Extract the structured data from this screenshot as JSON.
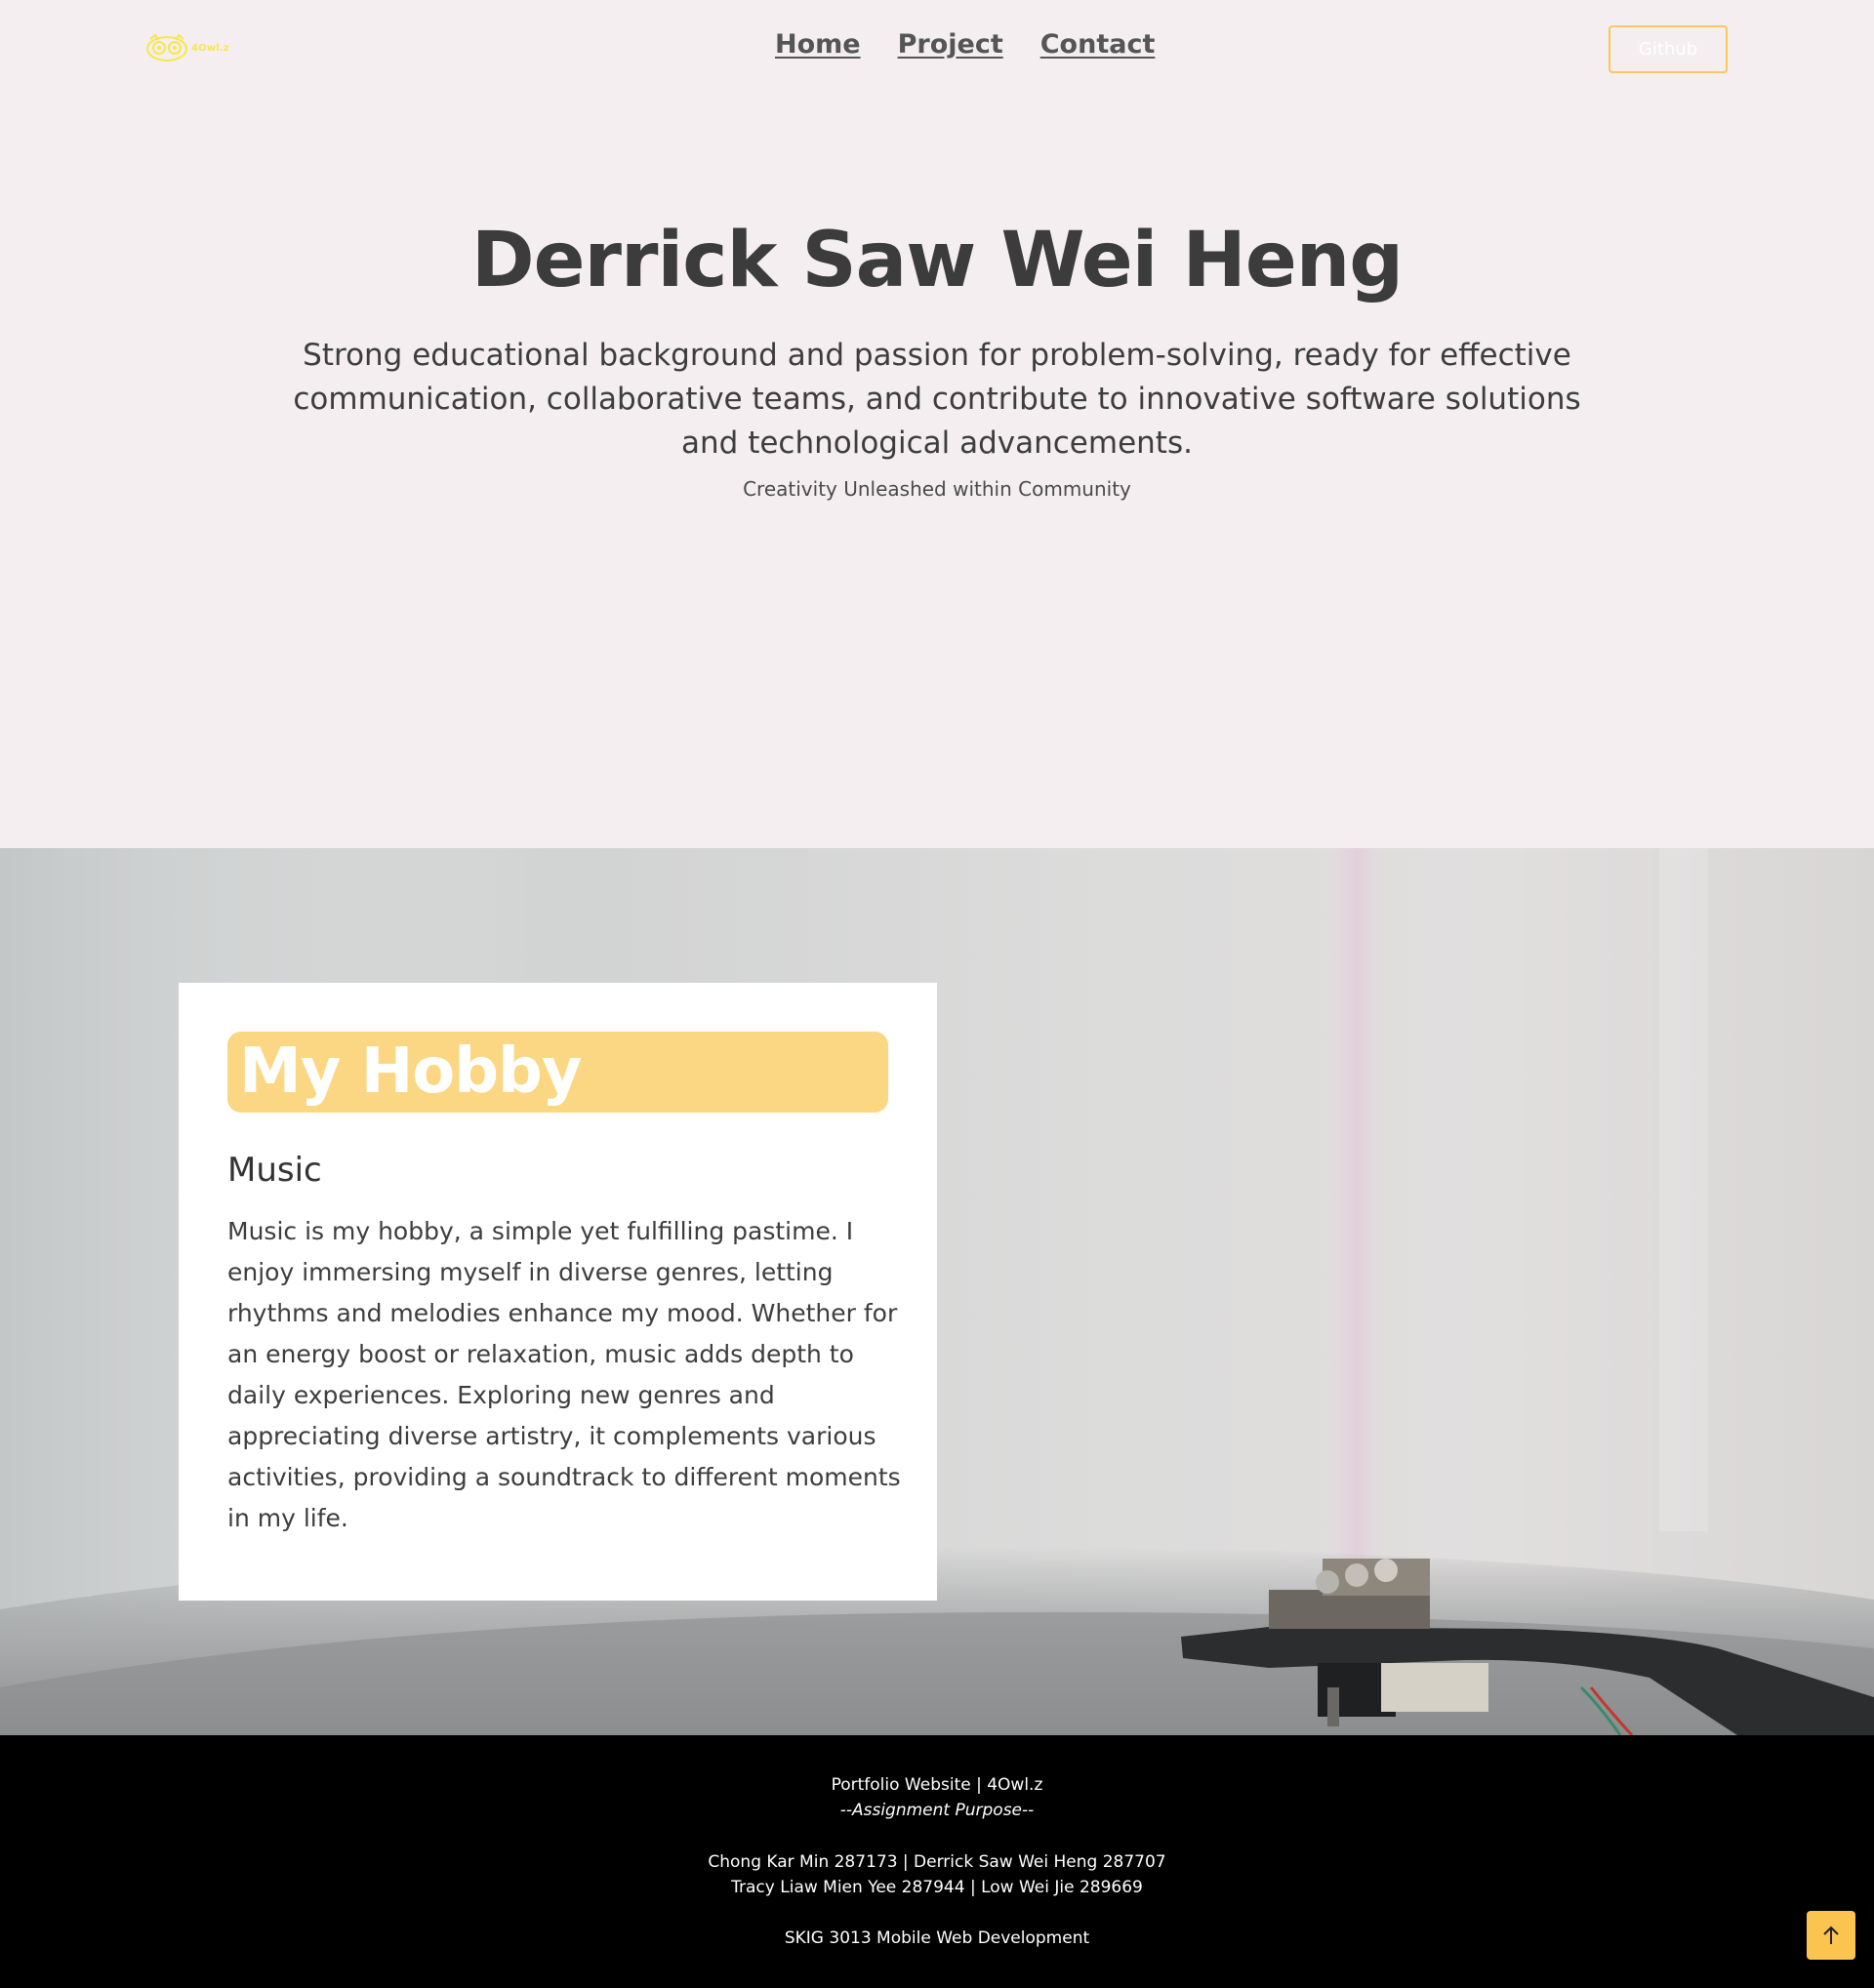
{
  "header": {
    "logo_text": "4Owl.z",
    "nav": [
      {
        "label": "Home"
      },
      {
        "label": "Project"
      },
      {
        "label": "Contact"
      }
    ],
    "github_label": "Github"
  },
  "hero": {
    "title": "Derrick Saw Wei Heng",
    "description": "Strong educational background and passion for problem-solving, ready for effective communication, collaborative teams, and contribute to innovative software solutions and technological advancements.",
    "tagline": "Creativity Unleashed within Community"
  },
  "hobby": {
    "heading": "My Hobby",
    "subheading": "Music",
    "text": "Music is my hobby, a simple yet fulfilling pastime. I enjoy immersing myself in diverse genres, letting rhythms and melodies enhance my mood. Whether for an energy boost or relaxation, music adds depth to daily experiences. Exploring new genres and appreciating diverse artistry, it complements various activities, providing a soundtrack to different moments in my life."
  },
  "footer": {
    "line1": "Portfolio Website | 4Owl.z",
    "line2": "--Assignment Purpose--",
    "line3": "Chong Kar Min 287173 | Derrick Saw Wei Heng 287707",
    "line4": "Tracy Liaw Mien Yee 287944 | Low Wei Jie 289669",
    "line5": "SKIG 3013 Mobile Web Development"
  },
  "colors": {
    "accent": "#fbc75a",
    "hobby_heading_bg": "#fbd783",
    "page_bg": "#f4eef1",
    "footer_bg": "#000000",
    "logo": "#f7e84a"
  },
  "icons": {
    "logo": "owl-logo-icon",
    "scroll_top": "arrow-up-icon"
  }
}
